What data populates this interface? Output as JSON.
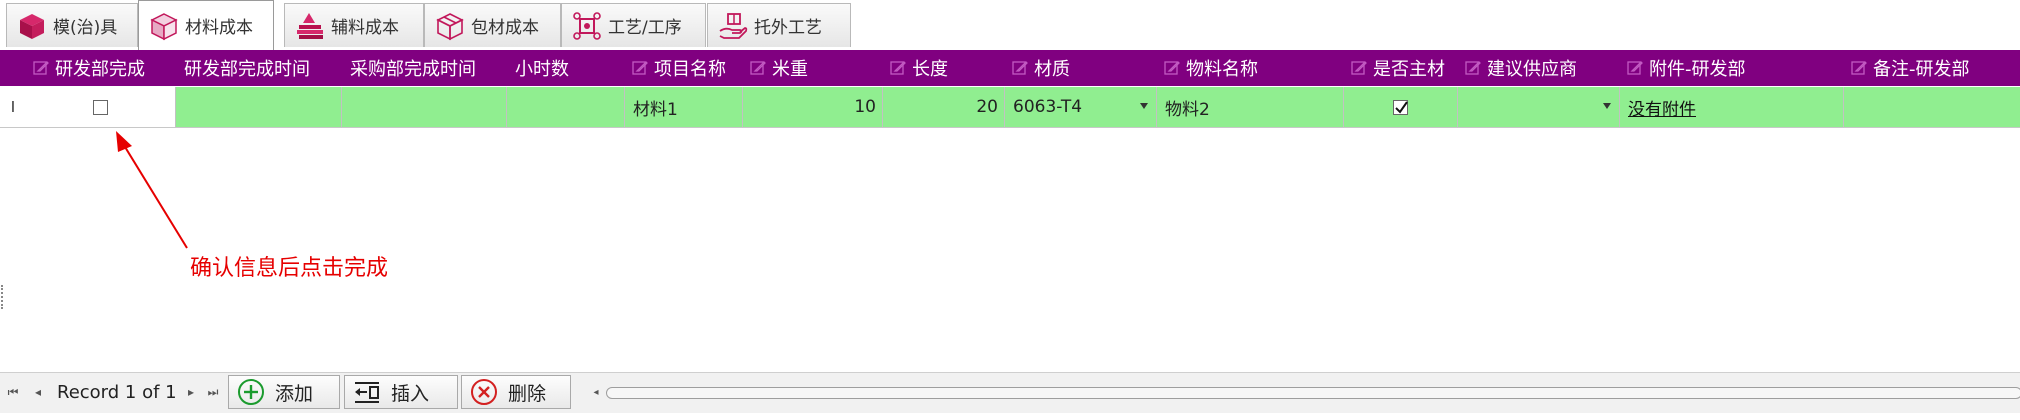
{
  "tabs": [
    {
      "label": "模(治)具",
      "icon": "cube-icon",
      "active": false
    },
    {
      "label": "材料成本",
      "icon": "cube-outline-icon",
      "active": true
    },
    {
      "label": "辅料成本",
      "icon": "stacked-books-icon",
      "active": false
    },
    {
      "label": "包材成本",
      "icon": "package-icon",
      "active": false
    },
    {
      "label": "工艺/工序",
      "icon": "process-network-icon",
      "active": false
    },
    {
      "label": "托外工艺",
      "icon": "hand-gift-icon",
      "active": false
    }
  ],
  "grid": {
    "headers": [
      {
        "label": "研发部完成",
        "editable": true
      },
      {
        "label": "研发部完成时间",
        "editable": false
      },
      {
        "label": "采购部完成时间",
        "editable": false
      },
      {
        "label": "小时数",
        "editable": false
      },
      {
        "label": "项目名称",
        "editable": true
      },
      {
        "label": "米重",
        "editable": true
      },
      {
        "label": "长度",
        "editable": true
      },
      {
        "label": "材质",
        "editable": true
      },
      {
        "label": "物料名称",
        "editable": true
      },
      {
        "label": "是否主材",
        "editable": true
      },
      {
        "label": "建议供应商",
        "editable": true
      },
      {
        "label": "附件-研发部",
        "editable": true
      },
      {
        "label": "备注-研发部",
        "editable": true
      }
    ],
    "row_indicator": "I",
    "row": {
      "rd_done_checked": false,
      "rd_done_time": "",
      "purchase_done_time": "",
      "hours": "",
      "item_name": "材料1",
      "meter_weight": "10",
      "length": "20",
      "material": "6063-T4",
      "material_name": "物料2",
      "is_main_material_checked": true,
      "supplier": "",
      "attachment": "没有附件",
      "remark": ""
    }
  },
  "annotation": {
    "text": "确认信息后点击完成",
    "color": "#e60000"
  },
  "navigator": {
    "record_text": "Record 1 of 1",
    "add_label": "添加",
    "insert_label": "插入",
    "delete_label": "删除"
  },
  "colors": {
    "header_bg": "#800080",
    "editable_cell_bg": "#90ee90",
    "header_text": "#ffffff"
  }
}
